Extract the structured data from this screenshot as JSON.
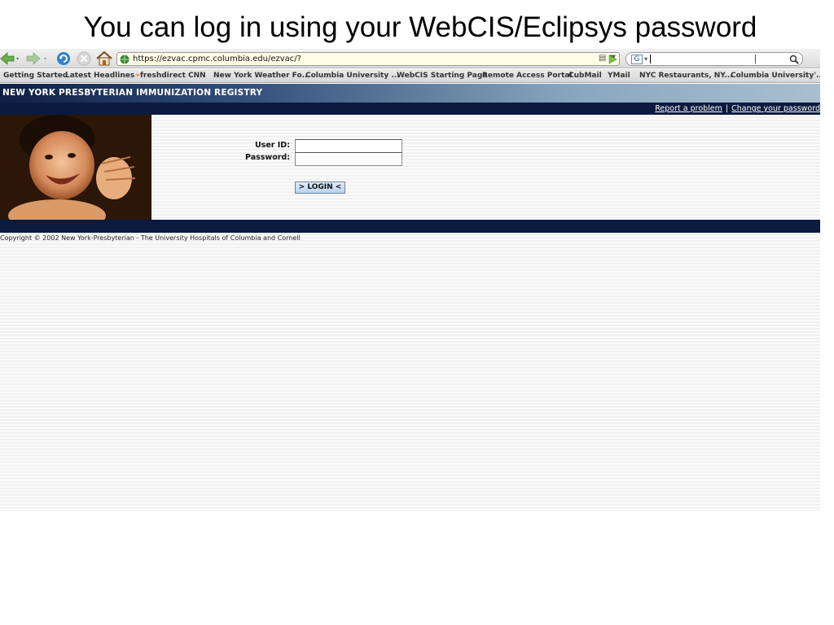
{
  "slide": {
    "title": "You can log in using your WebCIS/Eclipsys password"
  },
  "browser": {
    "url": "https://ezvac.cpmc.columbia.edu/ezvac/?",
    "bookmarks": [
      "Getting Started",
      "Latest Headlines",
      "freshdirect",
      "CNN",
      "New York Weather Fo...",
      "Columbia University ...",
      "WebCIS Starting Page",
      "Remote Access Portal",
      "CubMail",
      "YMail",
      "NYC Restaurants, NY...",
      "Columbia University'..."
    ],
    "icons": [
      "back-icon",
      "forward-icon",
      "reload-icon",
      "stop-icon",
      "home-icon",
      "site-globe-icon",
      "lock-icon",
      "go-icon",
      "google-icon",
      "magnifier-icon",
      "rss-icon"
    ]
  },
  "page": {
    "banner": "NEW YORK PRESBYTERIAN IMMUNIZATION REGISTRY",
    "links": {
      "report": "Report a problem",
      "separator": "|",
      "change_password": "Change your password"
    },
    "form": {
      "userid_label": "User ID:",
      "userid_value": "",
      "password_label": "Password:",
      "password_value": "",
      "login_button": "> LOGIN <"
    },
    "copyright": "Copyright © 2002 New York-Presbyterian - The University Hospitals of Columbia and Cornell"
  },
  "colors": {
    "banner_dark": "#0f1e45",
    "banner_light": "#a9bfd0",
    "navy_bar": "#0b1a3f",
    "url_bar_bg": "#fffde6",
    "button_blue": "#b9d2ec"
  }
}
